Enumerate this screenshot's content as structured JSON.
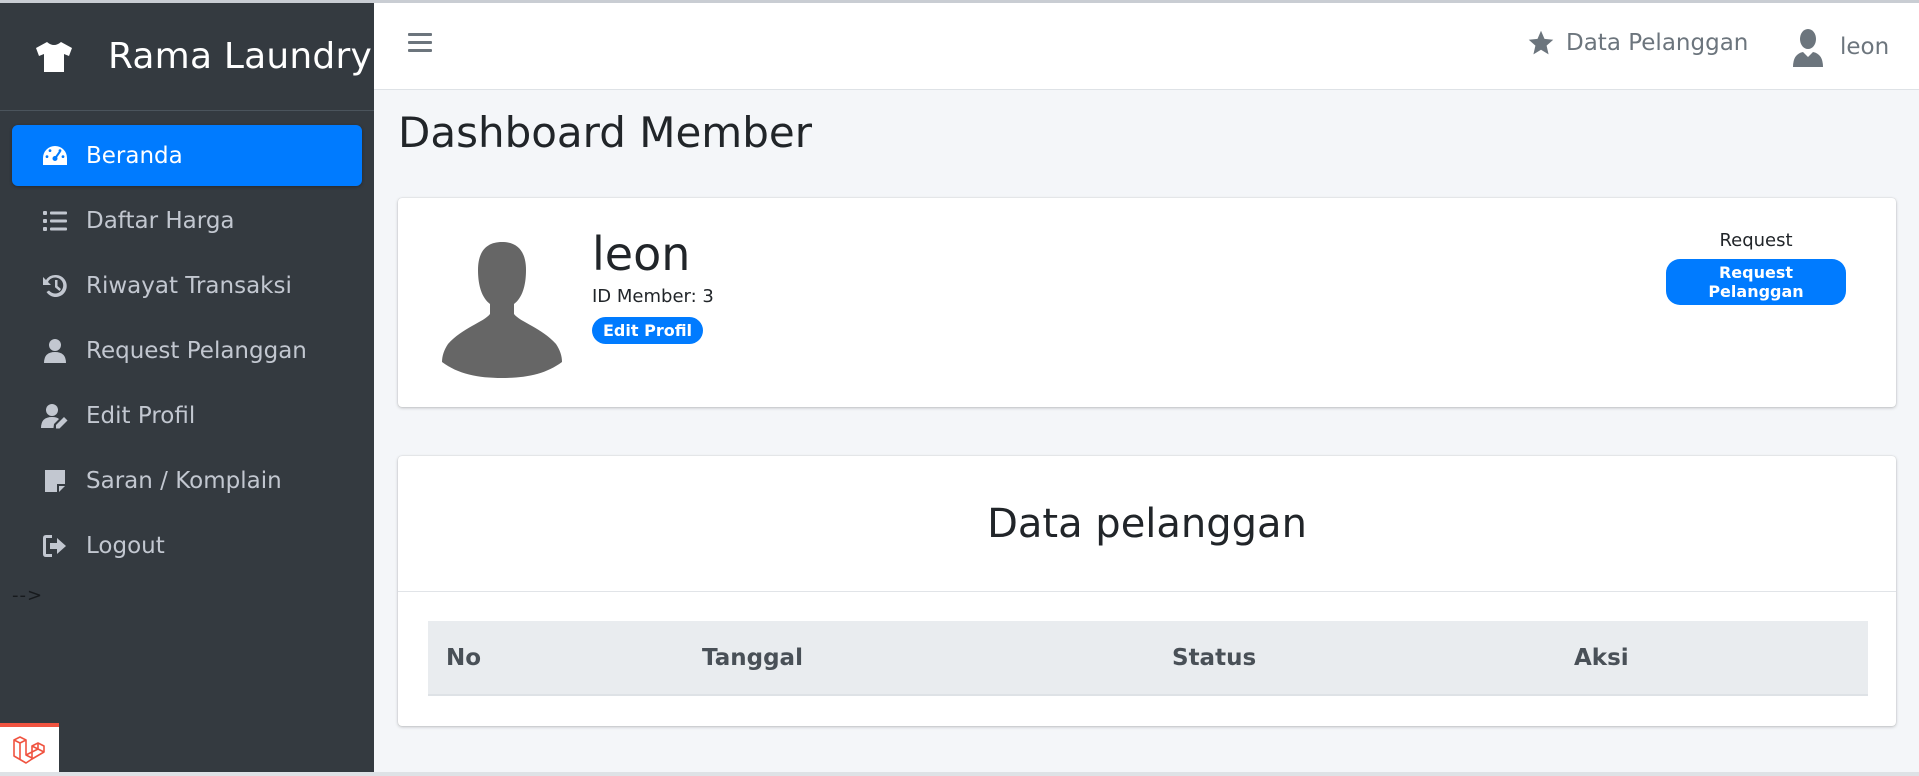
{
  "brand": {
    "name": "Rama Laundry",
    "icon": "tshirt-icon"
  },
  "sidebar": {
    "items": [
      {
        "label": "Beranda",
        "icon": "tachometer-icon",
        "active": true
      },
      {
        "label": "Daftar Harga",
        "icon": "list-icon",
        "active": false
      },
      {
        "label": "Riwayat Transaksi",
        "icon": "history-icon",
        "active": false
      },
      {
        "label": "Request Pelanggan",
        "icon": "user-icon",
        "active": false
      },
      {
        "label": "Edit Profil",
        "icon": "user-edit-icon",
        "active": false
      },
      {
        "label": "Saran / Komplain",
        "icon": "sticky-note-icon",
        "active": false
      },
      {
        "label": "Logout",
        "icon": "sign-out-icon",
        "active": false
      }
    ],
    "stray_text": "-->"
  },
  "topbar": {
    "menu_icon": "bars-icon",
    "data_link": "Data Pelanggan",
    "data_icon": "star-icon",
    "user_name": "leon",
    "user_icon": "user-silhouette-icon"
  },
  "page": {
    "title": "Dashboard Member"
  },
  "profile": {
    "name": "leon",
    "member_id": "ID Member: 3",
    "edit_button": "Edit Profil",
    "request_label": "Request",
    "request_button": "Request Pelanggan"
  },
  "data_table": {
    "title": "Data pelanggan",
    "columns": [
      "No",
      "Tanggal",
      "Status",
      "Aksi"
    ],
    "rows": []
  },
  "colors": {
    "sidebar_bg": "#343a40",
    "accent": "#007bff",
    "content_bg": "#f4f6f9",
    "laravel_red": "#f05340"
  }
}
